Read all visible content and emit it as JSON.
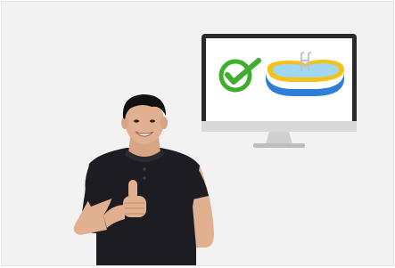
{
  "scene": {
    "background": "#f2f2f2",
    "monitor": {
      "frame_color": "#2a2a2a",
      "screen_color": "#ffffff",
      "stand_color": "#cfcfcf",
      "screen_icons": [
        "check-circle-icon",
        "inflatable-pool-icon"
      ]
    },
    "check_icon": {
      "color": "#3fae2f"
    },
    "pool_icon": {
      "rim_color": "#f5c21a",
      "body_color": "#2f7fd6",
      "water_color": "#9fd8f0",
      "ladder_color": "#b8c4cf"
    },
    "person": {
      "gesture": "thumbs-up",
      "shirt_color": "#1c1c22",
      "skin_color": "#e0b090",
      "hair_color": "#111111"
    }
  }
}
